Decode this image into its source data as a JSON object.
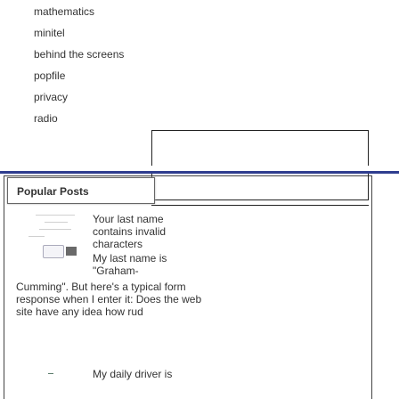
{
  "categories": {
    "items": [
      {
        "label": "mathematics"
      },
      {
        "label": "minitel"
      },
      {
        "label": "behind the screens"
      },
      {
        "label": "popfile"
      },
      {
        "label": "privacy"
      },
      {
        "label": "radio"
      }
    ]
  },
  "popular_posts": {
    "title": "Popular Posts",
    "posts": [
      {
        "intro": "Your last name contains invalid characters",
        "line2": "My last name is \"Graham-",
        "body": "Cumming\". But here's a typical form response when I enter it: Does the web site have any idea how rud"
      },
      {
        "intro": "My daily driver is"
      }
    ]
  }
}
